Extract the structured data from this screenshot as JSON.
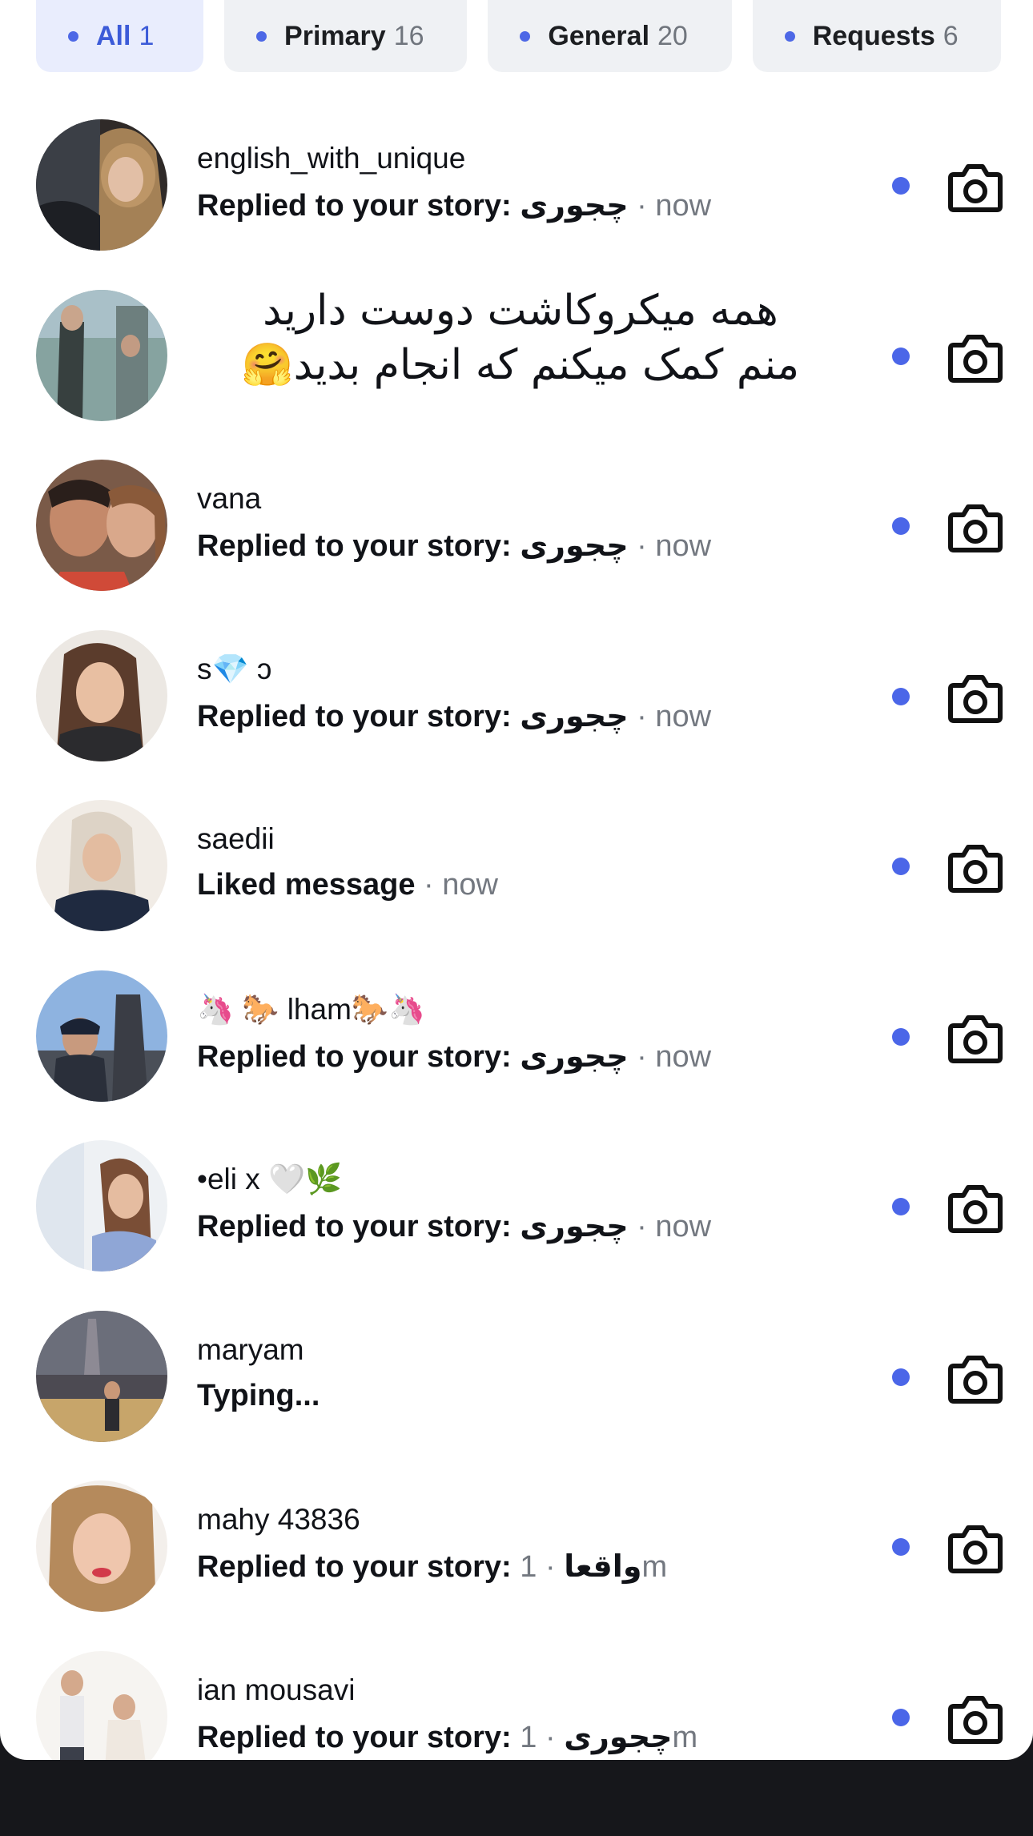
{
  "tabs": [
    {
      "label": "All",
      "count": "1",
      "active": true
    },
    {
      "label": "Primary",
      "count": "16"
    },
    {
      "label": "General",
      "count": "20"
    },
    {
      "label": "Requests",
      "count": "6"
    }
  ],
  "overlay_message": {
    "line1": "همه میکروکاشت دوست دارید",
    "line2": "منم کمک میکنم که انجام بدید🤗"
  },
  "threads": [
    {
      "name": "english_with_unique",
      "action": "Replied to your story: چجوری",
      "time": "now"
    },
    {
      "name": "",
      "action": "",
      "time": ""
    },
    {
      "name": "vana",
      "action": "Replied to your story: چجوری",
      "time": "now"
    },
    {
      "name": "s💎 ɔ",
      "action": "Replied to your story: چجوری",
      "time": "now"
    },
    {
      "name": "saedii",
      "action": "Liked message",
      "time": "now"
    },
    {
      "name": "🦄 🐎 lham🐎🦄",
      "action": "Replied to your story: چجوری",
      "time": "now"
    },
    {
      "name": "•eli x 🤍🌿",
      "action": "Replied to your story: چجوری",
      "time": "now"
    },
    {
      "name": "maryam",
      "action": "Typing...",
      "time": ""
    },
    {
      "name": "mahy 43836",
      "action": "Replied to your story: واقعا",
      "time": "1m"
    },
    {
      "name": "ian mousavi",
      "action": "Replied to your story: چجوری",
      "time": "1m"
    }
  ],
  "icons": {
    "camera": "camera-icon",
    "unread": "unread-dot"
  },
  "colors": {
    "accent": "#4b66e8",
    "tab_active_bg": "#e9edfd",
    "tab_bg": "#eff1f4"
  }
}
